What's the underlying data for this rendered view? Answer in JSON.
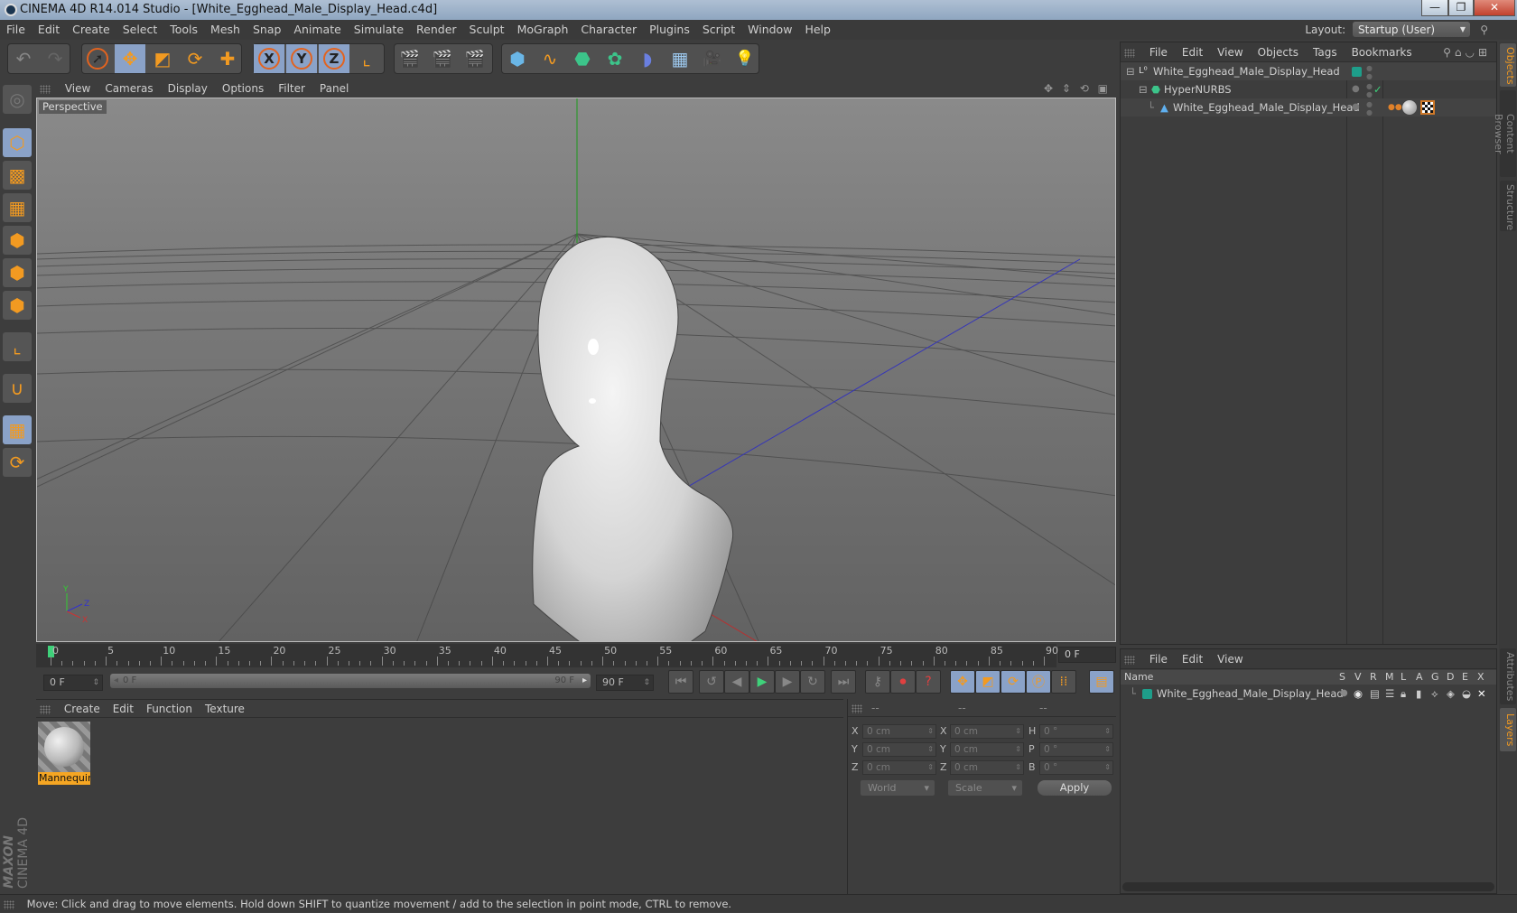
{
  "window": {
    "title": "CINEMA 4D R14.014 Studio - [White_Egghead_Male_Display_Head.c4d]",
    "minimize": "—",
    "restore": "❐",
    "close": "✕"
  },
  "menubar": [
    "File",
    "Edit",
    "Create",
    "Select",
    "Tools",
    "Mesh",
    "Snap",
    "Animate",
    "Simulate",
    "Render",
    "Sculpt",
    "MoGraph",
    "Character",
    "Plugins",
    "Script",
    "Window",
    "Help"
  ],
  "layout": {
    "label": "Layout:",
    "value": "Startup (User)"
  },
  "toolbar": {
    "undo": "↶",
    "redo": "↷",
    "tools": [
      {
        "name": "live-selection",
        "glyph": "➚"
      },
      {
        "name": "move",
        "glyph": "✥"
      },
      {
        "name": "scale",
        "glyph": "◩"
      },
      {
        "name": "rotate",
        "glyph": "⟳"
      },
      {
        "name": "last-tool",
        "glyph": "✚"
      }
    ],
    "axes": [
      "X",
      "Y",
      "Z"
    ],
    "coord_system_glyph": "⌞",
    "render_glyphs": [
      "🎬",
      "🎬",
      "🎬"
    ],
    "objects": [
      {
        "name": "cube",
        "glyph": "⬢"
      },
      {
        "name": "spline",
        "glyph": "∿"
      },
      {
        "name": "nurbs",
        "glyph": "⬣"
      },
      {
        "name": "array",
        "glyph": "✿"
      },
      {
        "name": "deformer",
        "glyph": "◗"
      },
      {
        "name": "floor",
        "glyph": "▦"
      },
      {
        "name": "camera",
        "glyph": "🎥"
      },
      {
        "name": "light",
        "glyph": "💡"
      }
    ]
  },
  "viewport": {
    "menu": [
      "View",
      "Cameras",
      "Display",
      "Options",
      "Filter",
      "Panel"
    ],
    "label": "Perspective",
    "nav_icons": "✥ ⇕ ⟲ ▣"
  },
  "timeline": {
    "ticks": [
      "0",
      "5",
      "10",
      "15",
      "20",
      "25",
      "30",
      "35",
      "40",
      "45",
      "50",
      "55",
      "60",
      "65",
      "70",
      "75",
      "80",
      "85",
      "90"
    ],
    "current_frame": "0 F",
    "start_frame": "0 F",
    "range_start": "0 F",
    "range_end": "90 F",
    "end_frame": "90 F"
  },
  "transport": {
    "first": "⏮",
    "prev_key": "↺",
    "prev": "◀",
    "play": "▶",
    "next": "▶",
    "next_key": "↻",
    "last": "⏭"
  },
  "materials": {
    "menu": [
      "Create",
      "Edit",
      "Function",
      "Texture"
    ],
    "items": [
      {
        "name": "Mannequin"
      }
    ]
  },
  "coordinates": {
    "headers": [
      "--",
      "--",
      "--"
    ],
    "rows": [
      {
        "l1": "X",
        "v1": "0 cm",
        "l2": "X",
        "v2": "0 cm",
        "l3": "H",
        "v3": "0 °"
      },
      {
        "l1": "Y",
        "v1": "0 cm",
        "l2": "Y",
        "v2": "0 cm",
        "l3": "P",
        "v3": "0 °"
      },
      {
        "l1": "Z",
        "v1": "0 cm",
        "l2": "Z",
        "v2": "0 cm",
        "l3": "B",
        "v3": "0 °"
      }
    ],
    "mode": "World",
    "size_mode": "Scale",
    "apply": "Apply"
  },
  "objects_panel": {
    "menu": [
      "File",
      "Edit",
      "View",
      "Objects",
      "Tags",
      "Bookmarks"
    ],
    "tree": [
      {
        "name": "White_Egghead_Male_Display_Head",
        "type": "null"
      },
      {
        "name": "HyperNURBS",
        "type": "hypernurbs"
      },
      {
        "name": "White_Egghead_Male_Display_Head",
        "type": "polygon"
      }
    ]
  },
  "side_tabs_top": [
    "Objects",
    "Content Browser",
    "Structure"
  ],
  "side_tabs_bottom": [
    "Attributes",
    "Layers"
  ],
  "layers_panel": {
    "menu": [
      "File",
      "Edit",
      "View"
    ],
    "columns": [
      "Name",
      "S",
      "V",
      "R",
      "M",
      "L",
      "A",
      "G",
      "D",
      "E",
      "X"
    ],
    "rows": [
      {
        "name": "White_Egghead_Male_Display_Head",
        "color": "#1e9e8a"
      }
    ]
  },
  "status": "Move: Click and drag to move elements. Hold down SHIFT to quantize movement / add to the selection in point mode, CTRL to remove.",
  "branding": {
    "line1": "MAXON",
    "line2": "CINEMA 4D"
  },
  "colors": {
    "accent_orange": "#f29a21",
    "selected_blue": "#8aa2c8",
    "layer_teal": "#1e9e8a"
  }
}
